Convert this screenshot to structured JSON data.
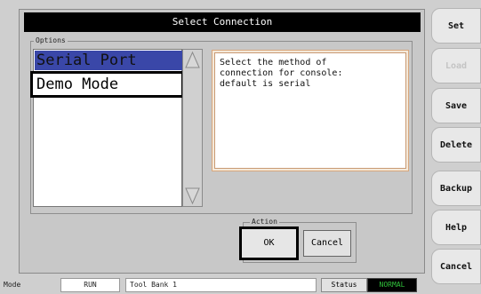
{
  "dialog": {
    "title": "Select Connection",
    "options_legend": "Options",
    "list_items": [
      "Serial Port",
      "Demo Mode"
    ],
    "description": "Select the method of\nconnection for console:\ndefault is serial",
    "action_legend": "Action",
    "ok_label": "OK",
    "cancel_label": "Cancel"
  },
  "sidebar": {
    "buttons": [
      {
        "label": "Set",
        "enabled": true
      },
      {
        "label": "Load",
        "enabled": false
      },
      {
        "label": "Save",
        "enabled": true
      },
      {
        "label": "Delete",
        "enabled": true
      },
      {
        "label": "Backup",
        "enabled": true
      },
      {
        "label": "Help",
        "enabled": true
      },
      {
        "label": "Cancel",
        "enabled": true
      }
    ]
  },
  "statusbar": {
    "mode_label": "Mode",
    "mode_value": "RUN",
    "tool_bank": "Tool Bank 1",
    "status_label": "Status",
    "status_value": "NORMAL"
  },
  "colors": {
    "selected_item": "#3a47a8",
    "status_normal_text": "#2fbf3a",
    "status_normal_bg": "#000000",
    "title_bg": "#000000"
  }
}
